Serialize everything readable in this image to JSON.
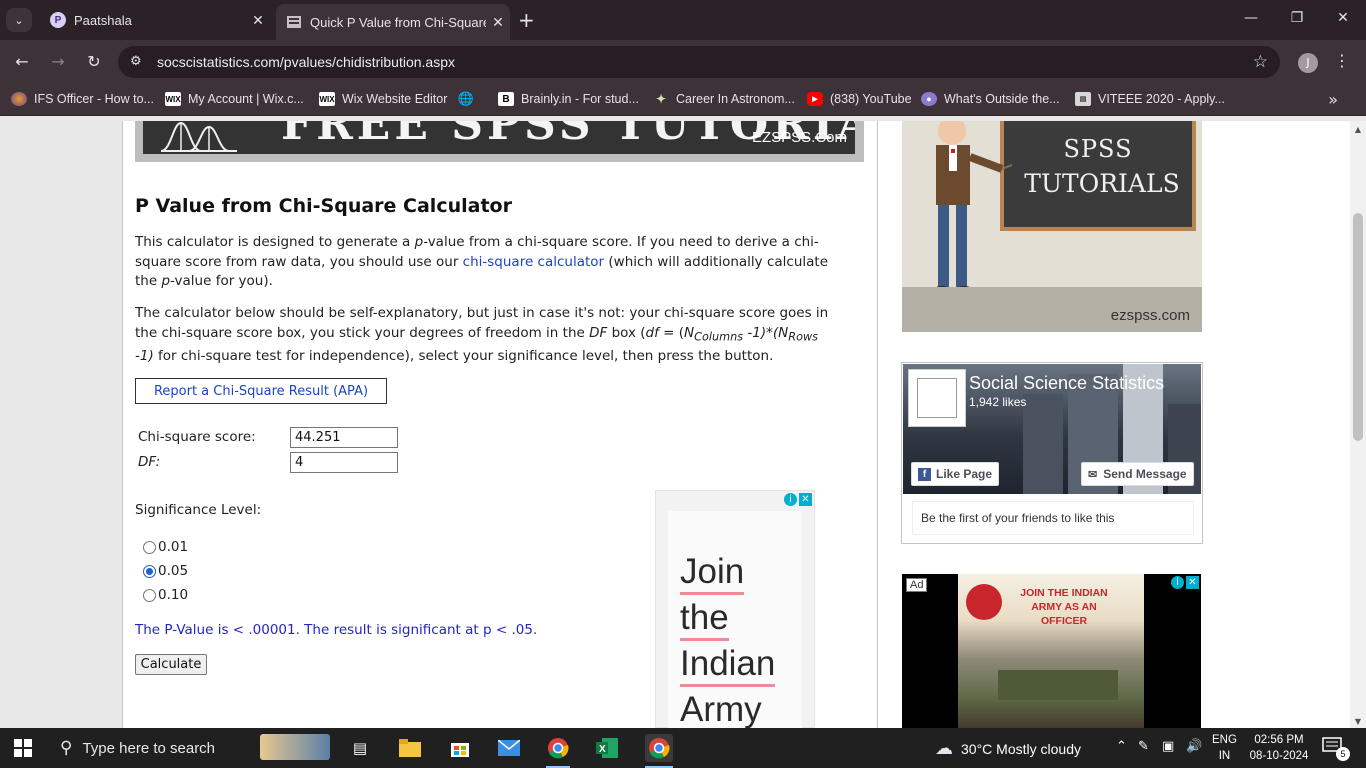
{
  "browser": {
    "tabs": [
      {
        "title": "Paatshala",
        "favicon": "P",
        "active": false
      },
      {
        "title": "Quick P Value from Chi-Square",
        "active": true
      }
    ],
    "url": "socscistatistics.com/pvalues/chidistribution.aspx",
    "profile_initial": "J",
    "bookmarks": [
      {
        "label": "IFS Officer - How to...",
        "icon": "globe-color-icon"
      },
      {
        "label": "My Account | Wix.c...",
        "icon": "wix-icon"
      },
      {
        "label": "Wix Website Editor",
        "icon": "wix-icon"
      },
      {
        "label": "",
        "icon": "globe-icon"
      },
      {
        "label": "Brainly.in - For stud...",
        "icon": "brainly-icon"
      },
      {
        "label": "Career In Astronom...",
        "icon": "star-cluster-icon"
      },
      {
        "label": "(838) YouTube",
        "icon": "youtube-icon"
      },
      {
        "label": "What's Outside the...",
        "icon": "planet-icon"
      },
      {
        "label": "VITEEE 2020 - Apply...",
        "icon": "newspaper-icon"
      }
    ]
  },
  "page": {
    "banner": {
      "brand": "EZSPSS.Com",
      "title": "FREE SPSS TUTORIALS"
    },
    "title": "P Value from Chi-Square Calculator",
    "para1_a": "This calculator is designed to generate a ",
    "para1_p": "p",
    "para1_b": "-value from a chi-square score. If you need to derive a chi-square score from raw data, you should use our ",
    "para1_link": "chi-square calculator",
    "para1_c": " (which will additionally calculate the ",
    "para1_p2": "p",
    "para1_d": "-value for you).",
    "para2_a": "The calculator below should be self-explanatory, but just in case it's not: your chi-square score goes in the chi-square score box, you stick your degrees of freedom in the ",
    "para2_df": "DF",
    "para2_b": " box (",
    "para2_formula_df": "df",
    "para2_formula_eq": " = (",
    "para2_n1": "N",
    "para2_sub1": "Columns",
    "para2_mid": " -1)*(",
    "para2_n2": "N",
    "para2_sub2": "Rows",
    "para2_end": " -1)",
    "para2_c": " for chi-square test for independence), select your significance level, then press the button.",
    "report_button": "Report a Chi-Square Result (APA)",
    "chi_label": "Chi-square score:",
    "chi_value": "44.251",
    "df_label": "DF:",
    "df_value": "4",
    "significance_label": "Significance Level:",
    "options": [
      {
        "label": "0.01",
        "checked": false
      },
      {
        "label": "0.05",
        "checked": true
      },
      {
        "label": "0.10",
        "checked": false
      }
    ],
    "result": "The P-Value is < .00001. The result is significant at p < .05.",
    "calculate_button": "Calculate"
  },
  "ads": {
    "middle_words": [
      "Join",
      "the",
      "Indian",
      "Army"
    ],
    "sidebar_board_line1": "SPSS",
    "sidebar_board_line2": "TUTORIALS",
    "sidebar_site": "ezspss.com",
    "facebook": {
      "page_name": "Social Science Statistics",
      "likes": "1,942 likes",
      "like_button": "Like Page",
      "message_button": "Send Message",
      "friends_text": "Be the first of your friends to like this"
    },
    "army_ad": {
      "badge": "Ad",
      "title": "JOIN THE INDIAN ARMY AS AN OFFICER"
    }
  },
  "taskbar": {
    "search_placeholder": "Type here to search",
    "weather": "30°C  Mostly cloudy",
    "lang_line1": "ENG",
    "lang_line2": "IN",
    "time": "02:56 PM",
    "date": "08-10-2024",
    "notifications": "5"
  },
  "colors": {
    "link": "#1a44c8",
    "result": "#2424c8",
    "radio_checked": "#1a62d6"
  }
}
